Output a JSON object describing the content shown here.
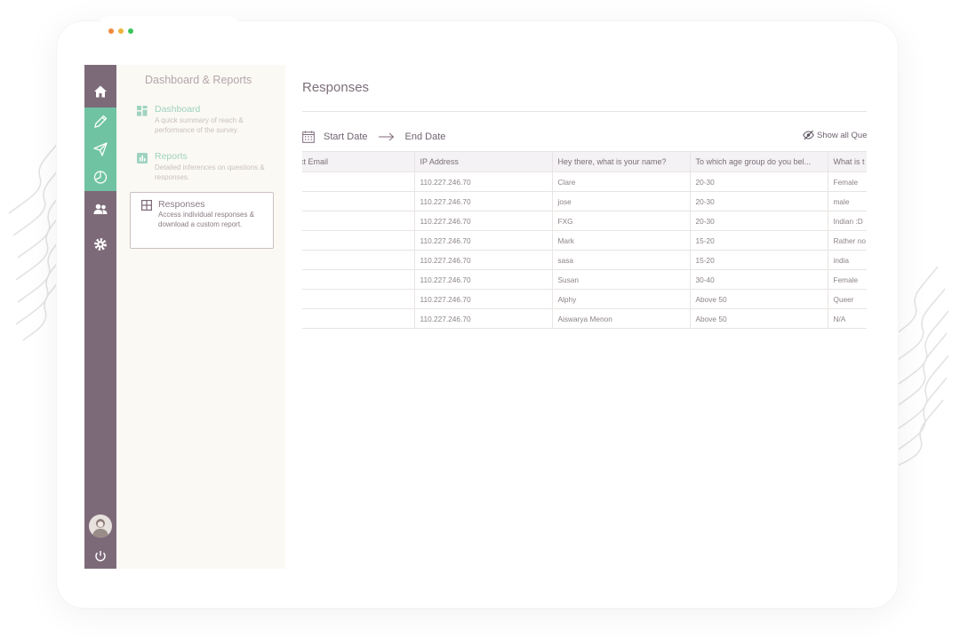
{
  "window": {
    "dots": [
      "#f08a3c",
      "#f0b23c",
      "#3cc45a"
    ]
  },
  "rail": {
    "items": [
      {
        "icon": "home-icon"
      },
      {
        "icon": "pencil-icon"
      },
      {
        "icon": "send-icon"
      },
      {
        "icon": "reports-clock-icon"
      },
      {
        "icon": "users-icon"
      },
      {
        "icon": "gear-icon"
      }
    ],
    "bottom": [
      {
        "icon": "avatar"
      },
      {
        "icon": "power-icon"
      }
    ]
  },
  "submenu": {
    "title": "Dashboard & Reports",
    "items": [
      {
        "label": "Dashboard",
        "desc": "A quick summary of reach & performance of the survey."
      },
      {
        "label": "Reports",
        "desc": "Detailed inferences on questions & responses."
      },
      {
        "label": "Responses",
        "desc": "Access individual responses & download a custom report."
      }
    ]
  },
  "main": {
    "title": "Responses",
    "start_date": "Start Date",
    "end_date": "End Date",
    "show_all": "Show all Que",
    "table": {
      "headers": [
        "act Email",
        "IP Address",
        "Hey there, what is your name?",
        "To which age group do you bel...",
        "What is t"
      ],
      "rows": [
        [
          "",
          "110.227.246.70",
          "Clare",
          "20-30",
          "Female"
        ],
        [
          "",
          "110.227.246.70",
          "jose",
          "20-30",
          "male"
        ],
        [
          "",
          "110.227.246.70",
          "FXG",
          "20-30",
          "Indian :D"
        ],
        [
          "",
          "110.227.246.70",
          "Mark",
          "15-20",
          "Rather no"
        ],
        [
          "",
          "110.227.246.70",
          "sasa",
          "15-20",
          "india"
        ],
        [
          "",
          "110.227.246.70",
          "Susan",
          "30-40",
          "Female"
        ],
        [
          "",
          "110.227.246.70",
          "Alphy",
          "Above 50",
          "Queer"
        ],
        [
          "",
          "110.227.246.70",
          "Aiswarya Menon",
          "Above 50",
          "N/A"
        ]
      ]
    }
  }
}
